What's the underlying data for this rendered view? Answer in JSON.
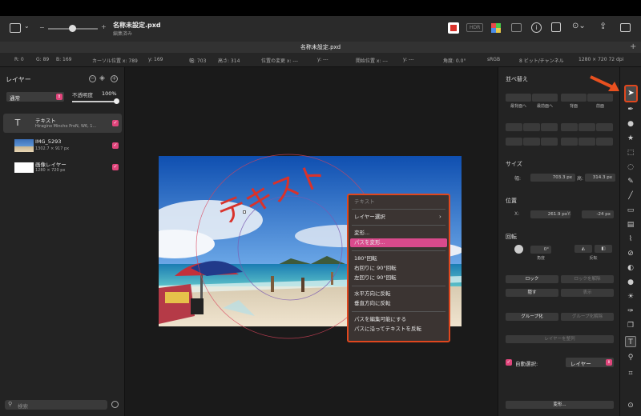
{
  "app": {
    "doc_title": "名称未設定.pxd",
    "doc_subtitle": "編集済み",
    "tab_title": "名称未設定.pxd",
    "hdr": "HDR"
  },
  "info": {
    "r": "R: 0",
    "g": "G: 89",
    "b": "B: 169",
    "cursor_x": "カーソル位置 x: 789",
    "cursor_y": "y: 169",
    "width": "幅: 703",
    "height": "高さ: 314",
    "pos_change_x": "位置の変更 x: ---",
    "pos_change_y": "y: ---",
    "start_x": "開始位置 x: ---",
    "start_y": "y: ---",
    "angle": "角度: 0.0°",
    "colorspace": "sRGB",
    "depth": "8 ビット/チャンネル",
    "size": "1280 × 720 72 dpi"
  },
  "layers": {
    "title": "レイヤー",
    "blend": "通常",
    "opacity_label": "不透明度",
    "opacity": "100%",
    "items": [
      {
        "name": "テキスト",
        "sub": "Hiragino Mincho ProN, W6, 1..."
      },
      {
        "name": "IMG_5293",
        "sub": "1302.7 × 917 px"
      },
      {
        "name": "画像レイヤー",
        "sub": "1280 × 720 px"
      }
    ],
    "search_placeholder": "検索"
  },
  "canvas": {
    "arc_text": "テキスト"
  },
  "menu": {
    "header": "テキスト",
    "items": [
      "レイヤー選択",
      "変形...",
      "パスを変形...",
      "180°回転",
      "右回りに 90°回転",
      "左回りに 90°回転",
      "水平方向に反転",
      "垂直方向に反転",
      "パスを編集可能にする",
      "パスに沿ってテキストを反転"
    ]
  },
  "right": {
    "arrange": "並べ替え",
    "front_most": "最背面へ",
    "front": "最前面へ",
    "back": "背面",
    "forward": "前面",
    "size": "サイズ",
    "w_label": "幅:",
    "w": "703.3 px",
    "h_label": "高:",
    "h": "314.3 px",
    "position": "位置",
    "x_label": "X:",
    "x": "261.9 px",
    "y_label": "Y:",
    "y": "-24 px",
    "rotate": "回転",
    "angle": "0°",
    "angle_label": "角度",
    "flip_label": "反転",
    "lock": "ロック",
    "unlock": "ロックを解除",
    "hide": "隠す",
    "show": "表示",
    "group": "グループ化",
    "ungroup": "グループ化解除",
    "align": "レイヤーを整列",
    "auto_select": "自動選択:",
    "auto_select_value": "レイヤー",
    "transform": "変形..."
  }
}
